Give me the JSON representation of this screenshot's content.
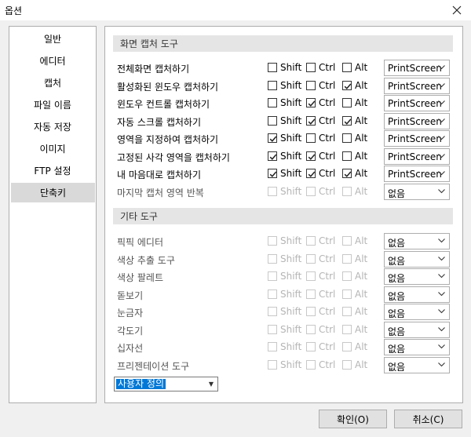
{
  "window": {
    "title": "옵션"
  },
  "sidebar": {
    "items": [
      {
        "label": "일반"
      },
      {
        "label": "에디터"
      },
      {
        "label": "캡처"
      },
      {
        "label": "파일 이름"
      },
      {
        "label": "자동 저장"
      },
      {
        "label": "이미지"
      },
      {
        "label": "FTP 설정"
      },
      {
        "label": "단축키",
        "selected": true
      }
    ]
  },
  "sections": {
    "capture": "화면 캡처 도구",
    "other": "기타 도구"
  },
  "modifiers": {
    "shift": "Shift",
    "ctrl": "Ctrl",
    "alt": "Alt"
  },
  "capture_rows": [
    {
      "label": "전체화면 캡처하기",
      "shift": false,
      "ctrl": false,
      "alt": false,
      "key": "PrintScreen",
      "enabled": true
    },
    {
      "label": "활성화된 윈도우 캡처하기",
      "shift": false,
      "ctrl": false,
      "alt": true,
      "key": "PrintScreen",
      "enabled": true
    },
    {
      "label": "윈도우 컨트롤 캡처하기",
      "shift": false,
      "ctrl": true,
      "alt": false,
      "key": "PrintScreen",
      "enabled": true
    },
    {
      "label": "자동 스크롤 캡처하기",
      "shift": false,
      "ctrl": true,
      "alt": true,
      "key": "PrintScreen",
      "enabled": true
    },
    {
      "label": "영역을 지정하여 캡처하기",
      "shift": true,
      "ctrl": false,
      "alt": false,
      "key": "PrintScreen",
      "enabled": true
    },
    {
      "label": "고정된 사각 영역을 캡처하기",
      "shift": true,
      "ctrl": true,
      "alt": false,
      "key": "PrintScreen",
      "enabled": true
    },
    {
      "label": "내 마음대로 캡처하기",
      "shift": true,
      "ctrl": true,
      "alt": true,
      "key": "PrintScreen",
      "enabled": true
    },
    {
      "label": "마지막 캡처 영역 반복",
      "shift": false,
      "ctrl": false,
      "alt": false,
      "key": "없음",
      "enabled": false
    }
  ],
  "other_rows": [
    {
      "label": "픽픽 에디터",
      "shift": false,
      "ctrl": false,
      "alt": false,
      "key": "없음",
      "enabled": false
    },
    {
      "label": "색상 추출 도구",
      "shift": false,
      "ctrl": false,
      "alt": false,
      "key": "없음",
      "enabled": false
    },
    {
      "label": "색상 팔레트",
      "shift": false,
      "ctrl": false,
      "alt": false,
      "key": "없음",
      "enabled": false
    },
    {
      "label": "돋보기",
      "shift": false,
      "ctrl": false,
      "alt": false,
      "key": "없음",
      "enabled": false
    },
    {
      "label": "눈금자",
      "shift": false,
      "ctrl": false,
      "alt": false,
      "key": "없음",
      "enabled": false
    },
    {
      "label": "각도기",
      "shift": false,
      "ctrl": false,
      "alt": false,
      "key": "없음",
      "enabled": false
    },
    {
      "label": "십자선",
      "shift": false,
      "ctrl": false,
      "alt": false,
      "key": "없음",
      "enabled": false
    },
    {
      "label": "프리젠테이션 도구",
      "shift": false,
      "ctrl": false,
      "alt": false,
      "key": "없음",
      "enabled": false
    }
  ],
  "preset": {
    "value": "사용자 정의"
  },
  "footer": {
    "ok": "확인(O)",
    "cancel": "취소(C)"
  }
}
